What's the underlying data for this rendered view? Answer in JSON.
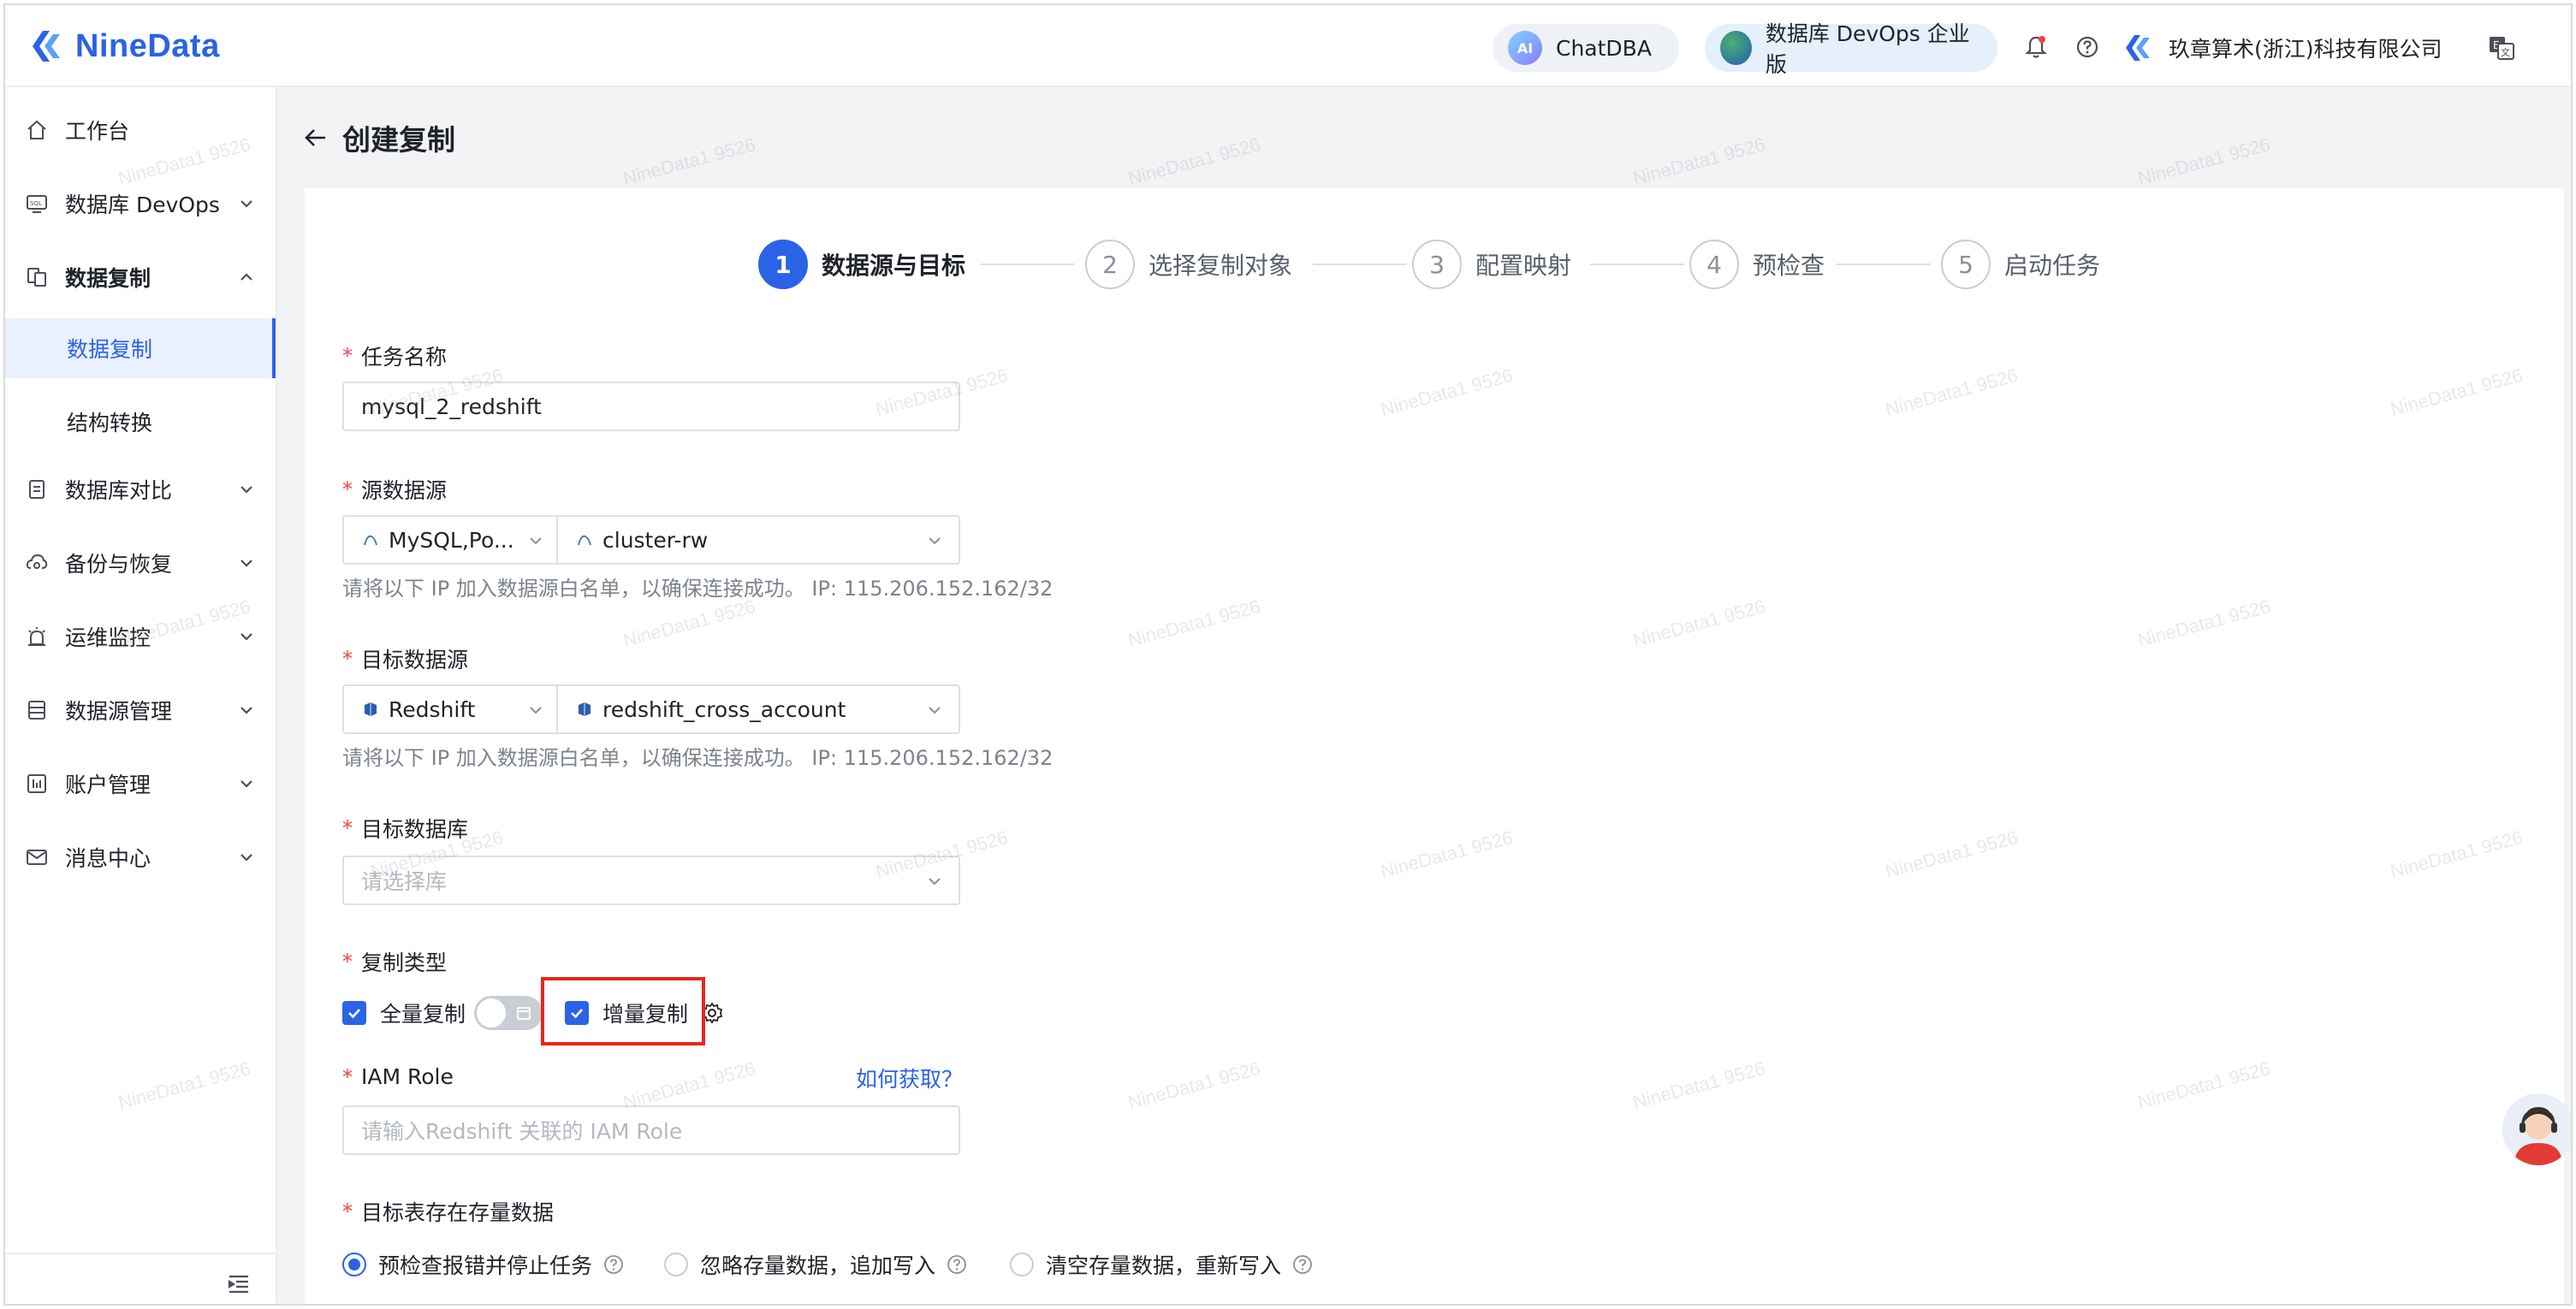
{
  "app": {
    "brand": "NineData"
  },
  "header": {
    "chatdba_label": "ChatDBA",
    "chatdba_badge": "AI",
    "devops_label": "数据库 DevOps 企业版",
    "org_name": "玖章算术(浙江)科技有限公司",
    "icons": [
      "bell-icon",
      "help-icon",
      "translate-icon"
    ]
  },
  "sidebar": {
    "items": [
      {
        "label": "工作台",
        "icon": "home-icon"
      },
      {
        "label": "数据库 DevOps",
        "icon": "sql-icon"
      },
      {
        "label": "数据复制",
        "icon": "replication-icon"
      },
      {
        "label": "数据库对比",
        "icon": "compare-icon"
      },
      {
        "label": "备份与恢复",
        "icon": "backup-icon"
      },
      {
        "label": "运维监控",
        "icon": "alarm-icon"
      },
      {
        "label": "数据源管理",
        "icon": "datasource-icon"
      },
      {
        "label": "账户管理",
        "icon": "account-icon"
      },
      {
        "label": "消息中心",
        "icon": "mail-icon"
      }
    ],
    "sub_items": [
      {
        "label": "数据复制",
        "active": true
      },
      {
        "label": "结构转换",
        "active": false
      }
    ]
  },
  "page": {
    "title": "创建复制"
  },
  "steps": [
    {
      "num": "1",
      "label": "数据源与目标",
      "active": true
    },
    {
      "num": "2",
      "label": "选择复制对象",
      "active": false
    },
    {
      "num": "3",
      "label": "配置映射",
      "active": false
    },
    {
      "num": "4",
      "label": "预检查",
      "active": false
    },
    {
      "num": "5",
      "label": "启动任务",
      "active": false
    }
  ],
  "form": {
    "task_name": {
      "label": "任务名称",
      "value": "mysql_2_redshift"
    },
    "source": {
      "label": "源数据源",
      "type": "MySQL,Po...",
      "instance": "cluster-rw",
      "hint": "请将以下 IP 加入数据源白名单，以确保连接成功。 IP: 115.206.152.162/32"
    },
    "target": {
      "label": "目标数据源",
      "type": "Redshift",
      "instance": "redshift_cross_account",
      "hint": "请将以下 IP 加入数据源白名单，以确保连接成功。 IP: 115.206.152.162/32"
    },
    "target_db": {
      "label": "目标数据库",
      "placeholder": "请选择库"
    },
    "copy_type": {
      "label": "复制类型",
      "full": "全量复制",
      "incremental": "增量复制",
      "full_checked": true,
      "incremental_checked": true,
      "full_switch_on": false
    },
    "iam_role": {
      "label": "IAM Role",
      "link": "如何获取？",
      "placeholder": "请输入Redshift 关联的 IAM Role"
    },
    "existing_data": {
      "label": "目标表存在存量数据",
      "options": [
        {
          "label": "预检查报错并停止任务",
          "selected": true
        },
        {
          "label": "忽略存量数据，追加写入",
          "selected": false
        },
        {
          "label": "清空存量数据，重新写入",
          "selected": false
        }
      ]
    }
  },
  "watermark": "NineData1 9526",
  "colors": {
    "accent": "#2a63e6",
    "required": "#f53f3f",
    "highlight": "#e8261c"
  }
}
